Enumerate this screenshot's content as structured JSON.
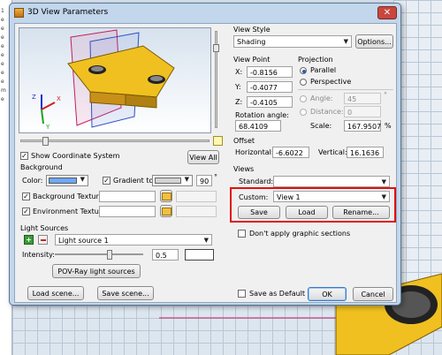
{
  "background": {
    "left_items": [
      "1",
      "e",
      "e",
      "e",
      "e",
      "e",
      "e",
      "e",
      "e",
      "m",
      "e"
    ]
  },
  "dialog": {
    "title": "3D View Parameters",
    "close_glyph": "✕"
  },
  "left": {
    "show_coordinate_system": "Show Coordinate System",
    "view_all": "View All",
    "background_header": "Background",
    "color_label": "Color:",
    "gradient_label": "Gradient to:",
    "gradient_value": "90",
    "degree": "°",
    "bg_texture_label": "Background Texture",
    "env_texture_label": "Environment Texture",
    "light_sources_header": "Light Sources",
    "light_source_selected": "Light source 1",
    "intensity_label": "Intensity:",
    "intensity_value": "0.5",
    "povray_button": "POV-Ray light sources",
    "load_scene": "Load scene...",
    "save_scene": "Save scene...",
    "axis_z": "Z",
    "axis_x": "X",
    "axis_y": "Y"
  },
  "right": {
    "view_style_header": "View Style",
    "view_style_value": "Shading",
    "options_button": "Options...",
    "viewpoint_header": "View Point",
    "x_label": "X:",
    "x_value": "-0.8156",
    "y_label": "Y:",
    "y_value": "-0.4077",
    "z_label": "Z:",
    "z_value": "-0.4105",
    "rotation_label": "Rotation angle:",
    "rotation_value": "68.4109",
    "projection_header": "Projection",
    "parallel": "Parallel",
    "perspective": "Perspective",
    "angle_label": "Angle:",
    "angle_value": "45",
    "distance_label": "Distance:",
    "distance_value": "0",
    "scale_label": "Scale:",
    "scale_value": "167.9507",
    "scale_unit": "%",
    "offset_header": "Offset",
    "horizontal_label": "Horizontal:",
    "horizontal_value": "-6.6022",
    "vertical_label": "Vertical:",
    "vertical_value": "16.1636",
    "views_header": "Views",
    "standard_label": "Standard:",
    "custom_label": "Custom:",
    "custom_value": "View 1",
    "save_button": "Save",
    "load_button": "Load",
    "rename_button": "Rename...",
    "dont_apply": "Don't apply graphic sections",
    "save_default": "Save as Default",
    "ok_button": "OK",
    "cancel_button": "Cancel"
  },
  "colors": {
    "accent_red": "#e01010",
    "part_yellow": "#f0c020",
    "bg_color_swatch": "#6fa8ff"
  }
}
